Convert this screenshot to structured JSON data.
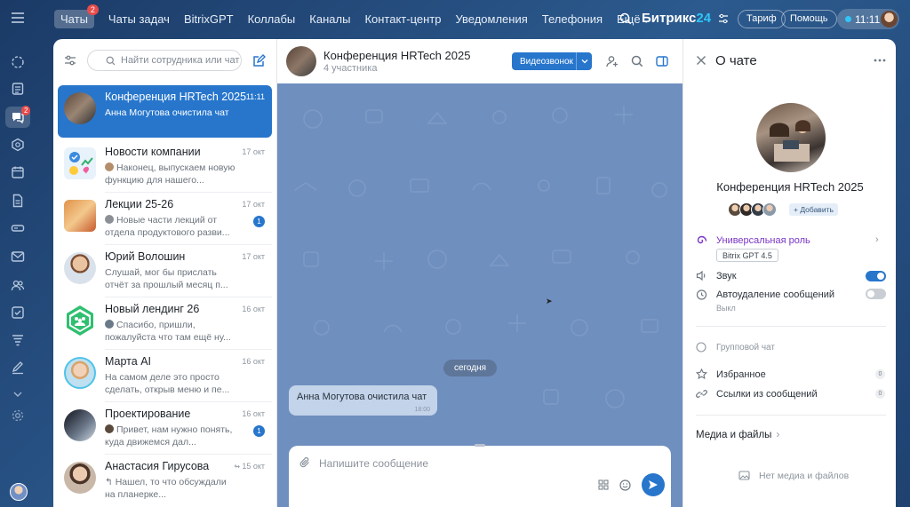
{
  "nav": {
    "items": [
      "Чаты",
      "Чаты задач",
      "BitrixGPT",
      "Коллабы",
      "Каналы",
      "Контакт-центр",
      "Уведомления",
      "Телефония",
      "Ещё"
    ],
    "chats_badge": "2",
    "brand": "Битрикс",
    "brand_num": "24",
    "tariff": "Тариф",
    "help": "Помощь",
    "time": "11:11"
  },
  "rail": {
    "chats_badge": "2"
  },
  "list": {
    "search_placeholder": "Найти сотрудника или чат",
    "chats": [
      {
        "name": "Конференция HRTech 2025",
        "date": "11:11",
        "msg": "Анна Могутова очистила чат",
        "count": ""
      },
      {
        "name": "Новости компании",
        "date": "17 окт",
        "msg": "Наконец, выпускаем новую функцию для нашего...",
        "count": ""
      },
      {
        "name": "Лекции 25-26",
        "date": "17 окт",
        "msg": "Новые части лекций от отдела продуктового разви...",
        "count": "1"
      },
      {
        "name": "Юрий Волошин",
        "date": "17 окт",
        "msg": "Слушай, мог бы прислать отчёт за прошлый месяц п...",
        "count": ""
      },
      {
        "name": "Новый лендинг 26",
        "date": "16 окт",
        "msg": "Спасибо, пришли, пожалуйста что там ещё ну...",
        "count": ""
      },
      {
        "name": "Марта AI",
        "date": "16 окт",
        "msg": "На самом деле это просто сделать, открыв меню и пе...",
        "count": ""
      },
      {
        "name": "Проектирование",
        "date": "16 окт",
        "msg": "Привет, нам нужно понять, куда движемся дал...",
        "count": "1"
      },
      {
        "name": "Анастасия Гирусова",
        "date": "15 окт",
        "msg": "Нашел, то что обсуждали на планерке...",
        "count": ""
      }
    ]
  },
  "chat": {
    "title": "Конференция HRTech 2025",
    "subtitle": "4 участника",
    "video_button": "Видеозвонок",
    "today": "сегодня",
    "system_msg": "Анна Могутова очистила чат",
    "system_time": "18:00",
    "compose_placeholder": "Напишите сообщение"
  },
  "info": {
    "title": "О чате",
    "chat_name": "Конференция HRTech 2025",
    "add": "+ Добавить",
    "role": "Универсальная роль",
    "model": "Bitrix GPT 4.5",
    "sound": "Звук",
    "autodelete": "Автоудаление сообщений",
    "autodelete_state": "Выкл",
    "group": "Групповой чат",
    "favorites": "Избранное",
    "favorites_count": "0",
    "links": "Ссылки из сообщений",
    "links_count": "0",
    "media": "Медиа и файлы",
    "no_media": "Нет медиа и файлов"
  },
  "colors": {
    "accent": "#2776cc",
    "badge": "#e94b4b",
    "role": "#7a35c5"
  }
}
